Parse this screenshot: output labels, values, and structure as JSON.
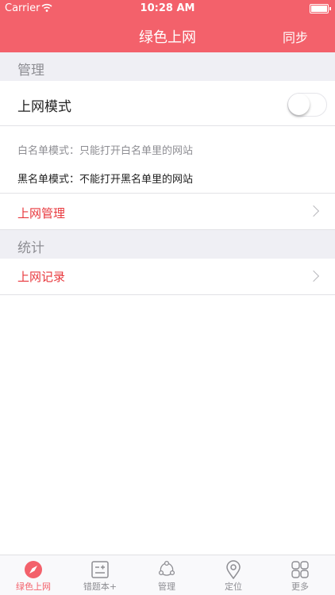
{
  "status": {
    "carrier": "Carrier",
    "time": "10:28 AM"
  },
  "nav": {
    "title": "绿色上网",
    "right_button": "同步"
  },
  "sections": {
    "manage": "管理",
    "stats": "统计"
  },
  "mode": {
    "label": "上网模式",
    "toggle_on": false
  },
  "descriptions": {
    "whitelist": "白名单模式：只能打开白名单里的网站",
    "blacklist": "黑名单模式：不能打开黑名单里的网站"
  },
  "links": {
    "manage": "上网管理",
    "records": "上网记录"
  },
  "tabs": [
    {
      "label": "绿色上网",
      "icon": "compass-icon",
      "active": true
    },
    {
      "label": "错题本+",
      "icon": "notebook-icon",
      "active": false
    },
    {
      "label": "管理",
      "icon": "share-network-icon",
      "active": false
    },
    {
      "label": "定位",
      "icon": "location-pin-icon",
      "active": false
    },
    {
      "label": "更多",
      "icon": "grid-icon",
      "active": false
    }
  ],
  "colors": {
    "accent": "#f3616b",
    "link": "#e8383d",
    "section_bg": "#efeff4"
  }
}
